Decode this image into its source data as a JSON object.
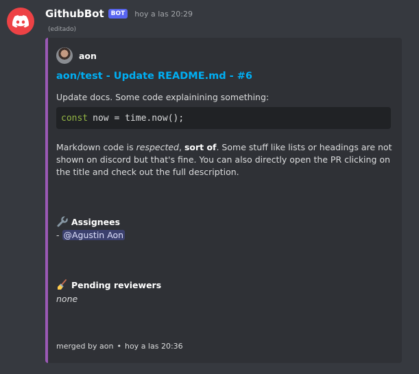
{
  "message": {
    "username": "GithubBot",
    "badge": "BOT",
    "timestamp": "hoy a las 20:29",
    "edited": "(editado)",
    "accent_color": "#9b59b6",
    "avatar_color": "#ed4245"
  },
  "embed": {
    "author": "aon",
    "title": "aon/test - Update README.md - #6",
    "description": "Update docs. Some code explainining something:",
    "code": {
      "keyword": "const",
      "rest": "now = time.now();"
    },
    "paragraph": {
      "part1": "Markdown code is ",
      "italic": "respected",
      "part2": ", ",
      "bold": "sort of",
      "part3": ". Some stuff like lists or headings are not shown on discord but that's fine. You can also directly open the PR clicking on the title and check out the full description."
    },
    "assignees": {
      "icon": "wrench-icon",
      "heading": "Assignees",
      "dash": "-",
      "mention": "@Agustin Aon"
    },
    "reviewers": {
      "icon": "broom-icon",
      "heading": "Pending reviewers",
      "value": "none"
    },
    "footer": {
      "merged_by": "merged by aon",
      "separator": "•",
      "time": "hoy a las 20:36"
    }
  }
}
